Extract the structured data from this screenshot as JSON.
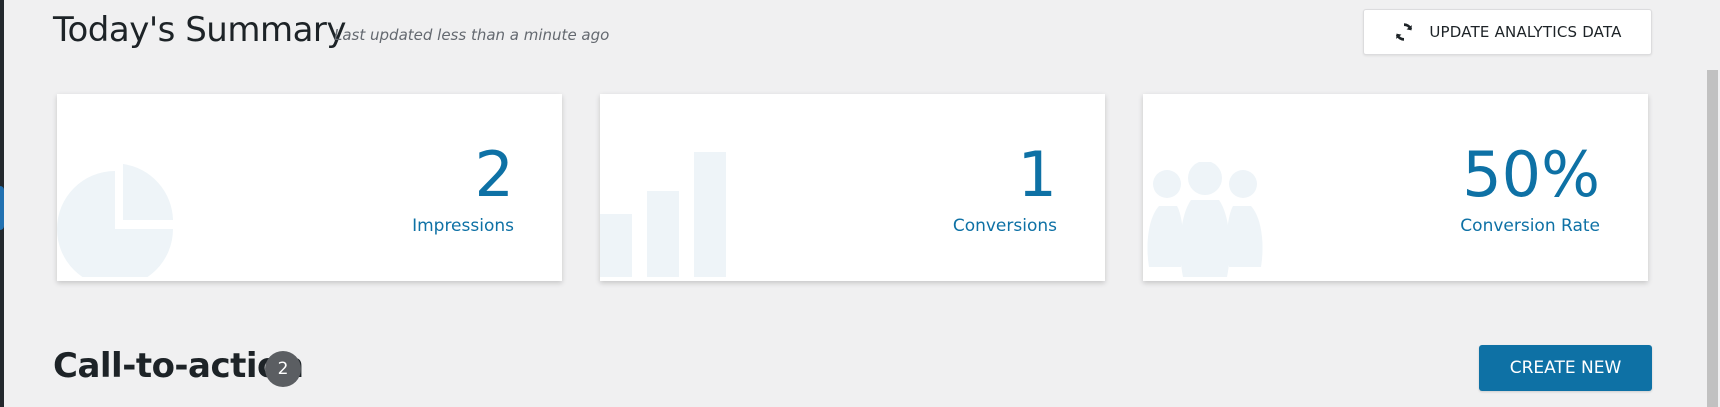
{
  "summary": {
    "title": "Today's Summary",
    "last_updated": "Last updated less than a minute ago",
    "update_button_label": "UPDATE ANALYTICS DATA",
    "update_icon": "refresh-icon"
  },
  "cards": [
    {
      "value": "2",
      "label": "Impressions",
      "icon": "pie-chart-icon"
    },
    {
      "value": "1",
      "label": "Conversions",
      "icon": "bar-chart-icon"
    },
    {
      "value": "50%",
      "label": "Conversion Rate",
      "icon": "users-icon"
    }
  ],
  "cta": {
    "title": "Call-to-action",
    "count": "2",
    "create_button_label": "CREATE NEW"
  },
  "colors": {
    "accent": "#0e71a5",
    "background": "#f0f0f1",
    "card_background": "#ffffff",
    "badge": "#5b5e62",
    "bg_icon": "#eef4f8"
  }
}
